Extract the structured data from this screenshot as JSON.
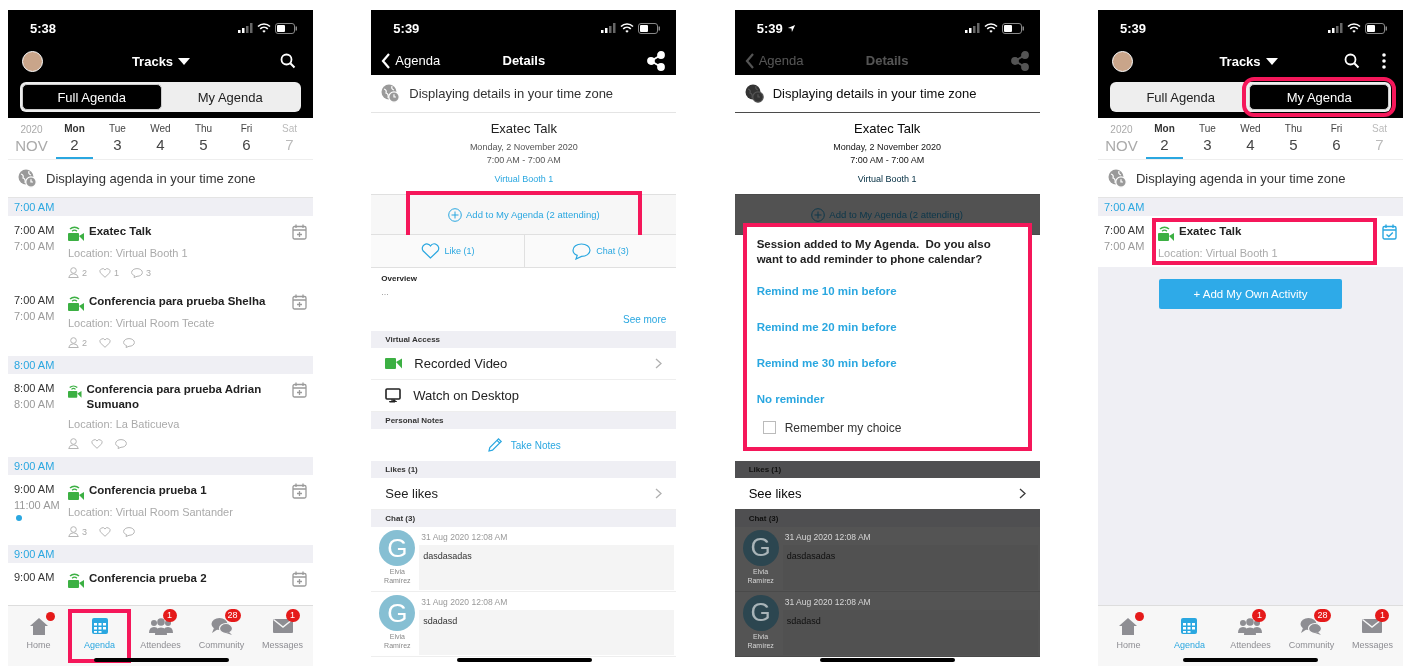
{
  "screens": [
    {
      "kind": "agenda",
      "status": {
        "time": "5:38",
        "location": false
      },
      "header": {
        "title": "Tracks",
        "more_menu": false
      },
      "segments": [
        {
          "label": "Full Agenda",
          "selected": true,
          "highlighted": false
        },
        {
          "label": "My Agenda",
          "selected": false,
          "highlighted": false
        }
      ],
      "dates": {
        "year": "2020",
        "month": "NOV",
        "days": [
          {
            "weekday": "Mon",
            "day": "2",
            "selected": true,
            "disabled": false
          },
          {
            "weekday": "Tue",
            "day": "3",
            "selected": false,
            "disabled": false
          },
          {
            "weekday": "Wed",
            "day": "4",
            "selected": false,
            "disabled": false
          },
          {
            "weekday": "Thu",
            "day": "5",
            "selected": false,
            "disabled": false
          },
          {
            "weekday": "Fri",
            "day": "6",
            "selected": false,
            "disabled": false
          },
          {
            "weekday": "Sat",
            "day": "7",
            "selected": false,
            "disabled": true
          }
        ]
      },
      "timezone_note": "Displaying agenda in your time zone",
      "groups": [
        {
          "time": "7:00 AM",
          "events": [
            {
              "start": "7:00 AM",
              "end": "7:00 AM",
              "title": "Exatec Talk",
              "location": "Location: Virtual Booth 1",
              "stats": [
                {
                  "kind": "attendees",
                  "count": "2"
                },
                {
                  "kind": "likes",
                  "count": "1"
                },
                {
                  "kind": "comments",
                  "count": "3"
                }
              ],
              "added": false,
              "dot": false,
              "highlighted": false
            },
            {
              "start": "7:00 AM",
              "end": "7:00 AM",
              "title": "Conferencia para prueba Shelha",
              "location": "Location: Virtual Room Tecate",
              "stats": [
                {
                  "kind": "attendees",
                  "count": "2"
                },
                {
                  "kind": "likes"
                },
                {
                  "kind": "comments"
                }
              ],
              "added": false,
              "dot": false,
              "highlighted": false
            }
          ]
        },
        {
          "time": "8:00 AM",
          "events": [
            {
              "start": "8:00 AM",
              "end": "8:00 AM",
              "title": "Conferencia para prueba Adrian Sumuano",
              "location": "Location: La Baticueva",
              "stats": [
                {
                  "kind": "attendees"
                },
                {
                  "kind": "likes"
                },
                {
                  "kind": "comments"
                }
              ],
              "added": false,
              "dot": false,
              "highlighted": false
            }
          ]
        },
        {
          "time": "9:00 AM",
          "events": [
            {
              "start": "9:00 AM",
              "end": "11:00 AM",
              "title": "Conferencia prueba 1",
              "location": "Location: Virtual Room Santander",
              "stats": [
                {
                  "kind": "attendees",
                  "count": "3"
                },
                {
                  "kind": "likes"
                },
                {
                  "kind": "comments"
                }
              ],
              "added": false,
              "dot": true,
              "highlighted": false
            }
          ]
        },
        {
          "time": "9:00 AM",
          "events": [
            {
              "start": "9:00 AM",
              "title": "Conferencia prueba 2",
              "added": false,
              "dot": false,
              "highlighted": false
            }
          ]
        }
      ],
      "tabs": [
        {
          "kind": "home",
          "label": "Home",
          "selected": false,
          "dot": true,
          "highlighted": false
        },
        {
          "kind": "agenda",
          "label": "Agenda",
          "selected": true,
          "dot": false,
          "highlighted": true
        },
        {
          "kind": "attendees",
          "label": "Attendees",
          "badge": "1",
          "selected": false,
          "dot": false,
          "highlighted": false
        },
        {
          "kind": "community",
          "label": "Community",
          "badge": "28",
          "selected": false,
          "dot": false,
          "highlighted": false
        },
        {
          "kind": "messages",
          "label": "Messages",
          "badge": "1",
          "selected": false,
          "dot": false,
          "highlighted": false
        }
      ]
    },
    {
      "kind": "details",
      "dimmed": false,
      "status": {
        "time": "5:39",
        "location": false
      },
      "nav": {
        "back": "Agenda",
        "title": "Details"
      },
      "timezone_note": "Displaying details in your time zone",
      "event": {
        "title": "Exatec Talk",
        "date": "Monday, 2 November 2020",
        "time": "7:00 AM - 7:00 AM",
        "location": "Virtual Booth 1"
      },
      "add_action": {
        "label": "Add to My Agenda (2 attending)",
        "highlighted": true
      },
      "actions": [
        {
          "kind": "like",
          "label": "Like (1)"
        },
        {
          "kind": "chat",
          "label": "Chat (3)"
        }
      ],
      "overview": {
        "heading": "Overview",
        "text": "...",
        "more": "See more"
      },
      "virtual_access": {
        "heading": "Virtual Access",
        "items": [
          {
            "kind": "video",
            "label": "Recorded Video",
            "chevron": true
          },
          {
            "kind": "desktop",
            "label": "Watch on Desktop",
            "chevron": false
          }
        ]
      },
      "notes": {
        "heading": "Personal Notes",
        "action": "Take Notes"
      },
      "likes": {
        "heading": "Likes (1)",
        "action": "See likes"
      },
      "chat": {
        "heading": "Chat (3)",
        "messages": [
          {
            "initial": "G",
            "author": "Elvia Ramírez",
            "time": "31 Aug 2020 12:08 AM",
            "text": "dasdasadas"
          },
          {
            "initial": "G",
            "author": "Elvia Ramírez",
            "time": "31 Aug 2020 12:08 AM",
            "text": "sdadasd"
          }
        ]
      }
    },
    {
      "kind": "details",
      "dimmed": true,
      "status": {
        "time": "5:39",
        "location": true
      },
      "nav": {
        "back": "Agenda",
        "title": "Details"
      },
      "timezone_note": "Displaying details in your time zone",
      "event": {
        "title": "Exatec Talk",
        "date": "Monday, 2 November 2020",
        "time": "7:00 AM - 7:00 AM",
        "location": "Virtual Booth 1"
      },
      "add_action": {
        "label": "Add to My Agenda (2 attending)",
        "highlighted": false
      },
      "dialog": {
        "message": "Session added to My Agenda.  Do you also want to add reminder to phone calendar?",
        "options": [
          "Remind me 10 min before",
          "Remind me 20 min before",
          "Remind me 30 min before",
          "No reminder"
        ],
        "remember": {
          "label": "Remember my choice",
          "checked": false
        },
        "highlighted": true
      },
      "likes": {
        "heading": "Likes (1)",
        "action": "See likes"
      },
      "chat": {
        "heading": "Chat (3)",
        "messages": [
          {
            "initial": "G",
            "author": "Elvia Ramírez",
            "time": "31 Aug 2020 12:08 AM",
            "text": "dasdasadas"
          },
          {
            "initial": "G",
            "author": "Elvia Ramírez",
            "time": "31 Aug 2020 12:08 AM",
            "text": "sdadasd"
          }
        ]
      }
    },
    {
      "kind": "agenda",
      "status": {
        "time": "5:39",
        "location": false
      },
      "header": {
        "title": "Tracks",
        "more_menu": true
      },
      "segments": [
        {
          "label": "Full Agenda",
          "selected": false,
          "highlighted": false
        },
        {
          "label": "My Agenda",
          "selected": true,
          "highlighted": true
        }
      ],
      "dates": {
        "year": "2020",
        "month": "NOV",
        "days": [
          {
            "weekday": "Mon",
            "day": "2",
            "selected": true,
            "disabled": false
          },
          {
            "weekday": "Tue",
            "day": "3",
            "selected": false,
            "disabled": false
          },
          {
            "weekday": "Wed",
            "day": "4",
            "selected": false,
            "disabled": false
          },
          {
            "weekday": "Thu",
            "day": "5",
            "selected": false,
            "disabled": false
          },
          {
            "weekday": "Fri",
            "day": "6",
            "selected": false,
            "disabled": false
          },
          {
            "weekday": "Sat",
            "day": "7",
            "selected": false,
            "disabled": true
          }
        ]
      },
      "timezone_note": "Displaying agenda in your time zone",
      "groups": [
        {
          "time": "7:00 AM",
          "events": [
            {
              "start": "7:00 AM",
              "end": "7:00 AM",
              "title": "Exatec Talk",
              "location": "Location: Virtual Booth 1",
              "added": true,
              "dot": false,
              "highlighted": true
            }
          ]
        }
      ],
      "add_activity": "+ Add My Own Activity",
      "tabs": [
        {
          "kind": "home",
          "label": "Home",
          "selected": false,
          "dot": true,
          "highlighted": false
        },
        {
          "kind": "agenda",
          "label": "Agenda",
          "selected": true,
          "dot": false,
          "highlighted": false
        },
        {
          "kind": "attendees",
          "label": "Attendees",
          "badge": "1",
          "selected": false,
          "dot": false,
          "highlighted": false
        },
        {
          "kind": "community",
          "label": "Community",
          "badge": "28",
          "selected": false,
          "dot": false,
          "highlighted": false
        },
        {
          "kind": "messages",
          "label": "Messages",
          "badge": "1",
          "selected": false,
          "dot": false,
          "highlighted": false
        }
      ]
    }
  ]
}
